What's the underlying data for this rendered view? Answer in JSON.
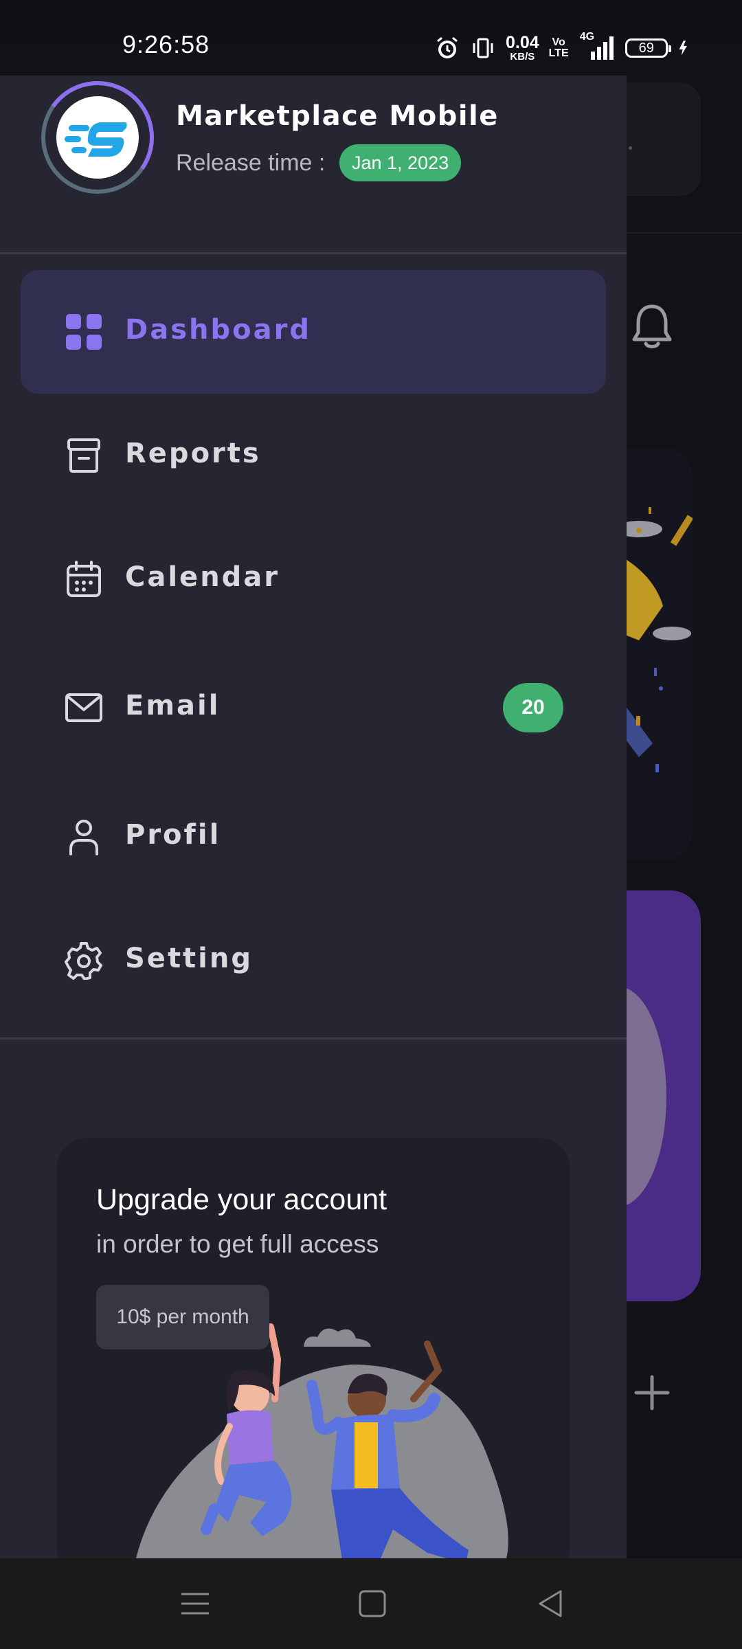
{
  "status_bar": {
    "time": "9:26:58",
    "net_speed_value": "0.04",
    "net_speed_unit": "KB/S",
    "volte_top": "Vo",
    "volte_bottom": "LTE",
    "network_type": "4G",
    "battery_level": "69",
    "icons": [
      "alarm-icon",
      "vibrate-icon",
      "signal-icon",
      "battery-icon",
      "charging-icon"
    ]
  },
  "drawer": {
    "app_name": "Marketplace Mobile",
    "release_label": "Release time :",
    "release_date": "Jan 1, 2023",
    "nav_items": [
      {
        "label": "Dashboard",
        "icon": "grid-icon",
        "active": true
      },
      {
        "label": "Reports",
        "icon": "archive-icon",
        "active": false
      },
      {
        "label": "Calendar",
        "icon": "calendar-icon",
        "active": false
      },
      {
        "label": "Email",
        "icon": "mail-icon",
        "active": false,
        "badge": "20"
      },
      {
        "label": "Profil",
        "icon": "user-icon",
        "active": false
      },
      {
        "label": "Setting",
        "icon": "gear-icon",
        "active": false
      }
    ],
    "upgrade": {
      "title": "Upgrade your account",
      "subtitle": "in order to get full access",
      "price_button": "10$ per month"
    }
  },
  "colors": {
    "drawer_bg": "#252631",
    "accent": "#8b74ef",
    "active_bg": "#312f4f",
    "badge_green": "#3fb06f"
  },
  "system_nav": {
    "buttons": [
      "menu-icon",
      "home-icon",
      "back-icon"
    ]
  }
}
